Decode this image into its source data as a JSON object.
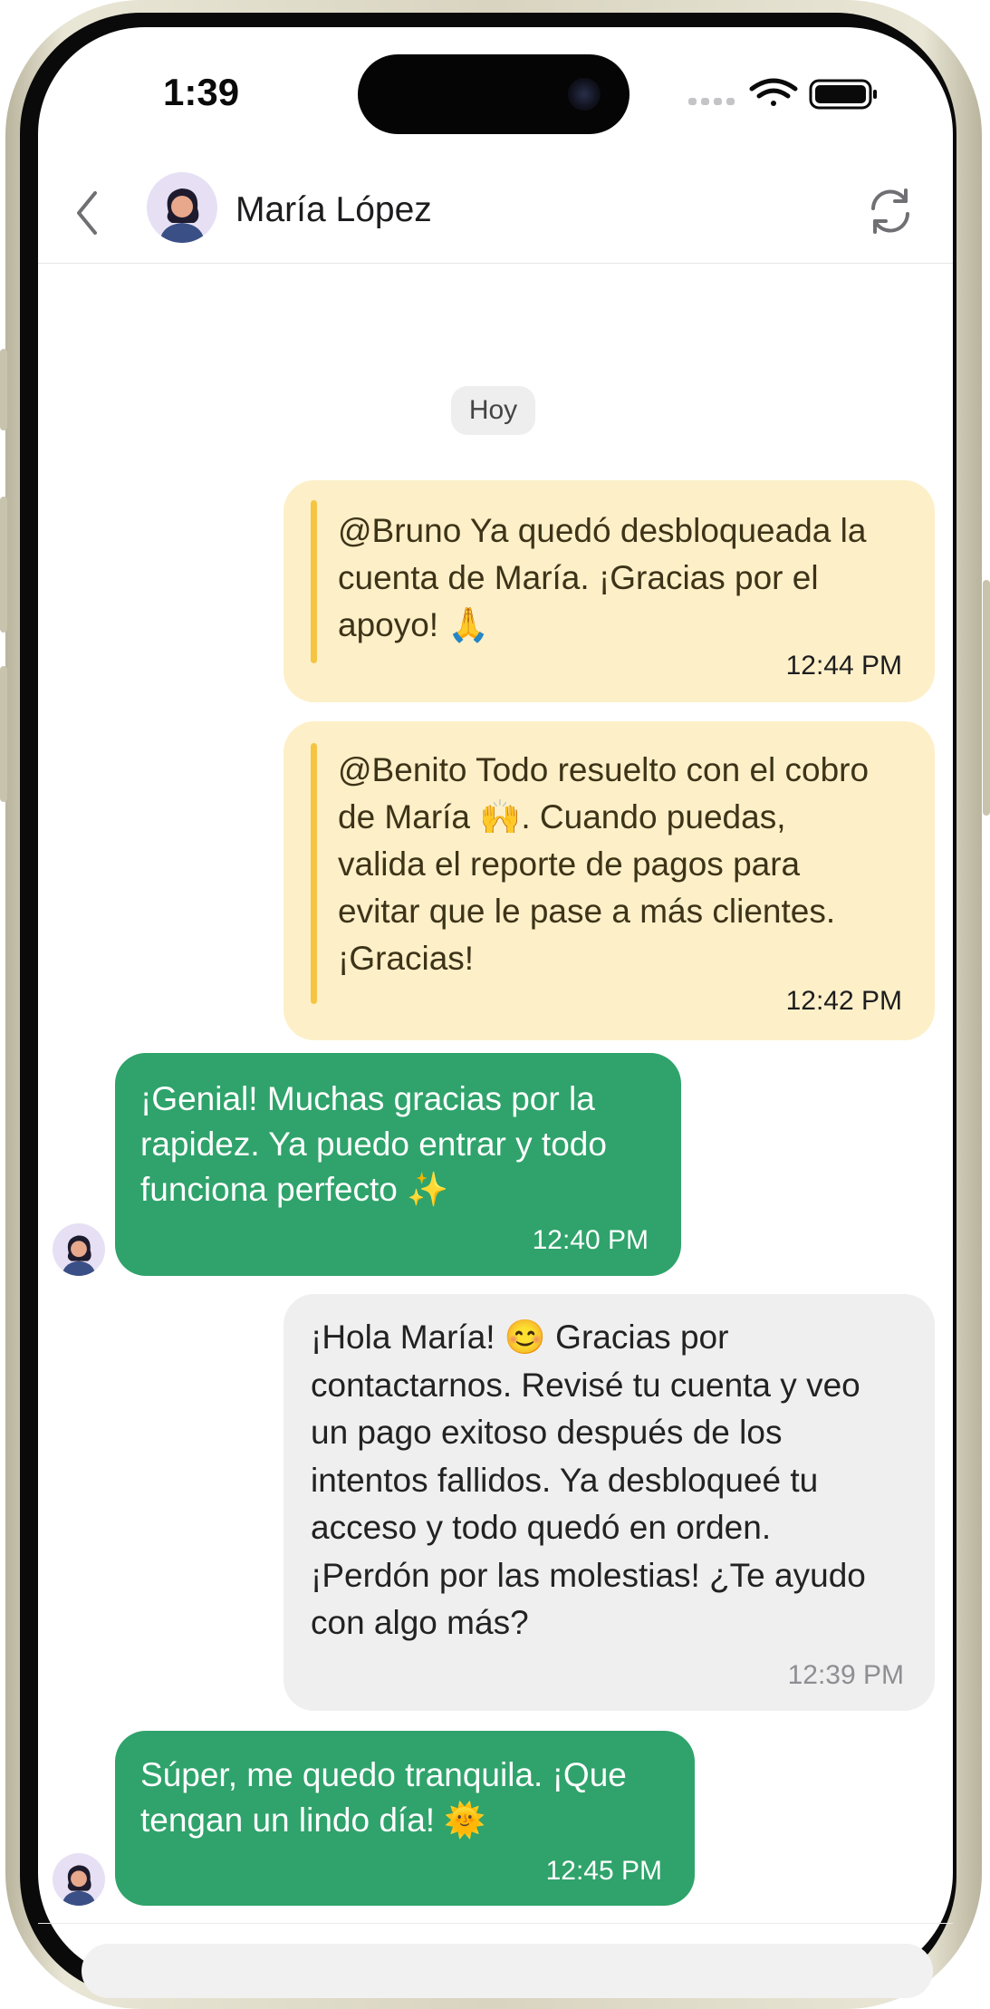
{
  "status_bar": {
    "time": "1:39"
  },
  "header": {
    "contact_name": "María López"
  },
  "date_chip": "Hoy",
  "messages": [
    {
      "kind": "internal-note",
      "lines": [
        "@Bruno Ya quedó desbloqueada la",
        "cuenta de María. ¡Gracias por el",
        "apoyo! 🙏"
      ],
      "time": "12:44 PM"
    },
    {
      "kind": "internal-note",
      "lines": [
        "@Benito Todo resuelto con el cobro",
        "de María 🙌. Cuando puedas,",
        "valida el reporte de pagos para",
        "evitar que le pase a más clientes.",
        "¡Gracias!"
      ],
      "time": "12:42 PM"
    },
    {
      "kind": "customer",
      "lines": [
        "¡Genial! Muchas gracias por la",
        "rapidez. Ya puedo entrar y todo",
        "funciona perfecto ✨"
      ],
      "time": "12:40 PM"
    },
    {
      "kind": "agent",
      "lines": [
        "¡Hola María! 😊 Gracias por",
        "contactarnos. Revisé tu cuenta y veo",
        "un pago exitoso después de los",
        "intentos fallidos. Ya desbloqueé tu",
        "acceso y todo quedó en orden.",
        "¡Perdón por las molestias! ¿Te ayudo",
        "con algo más?"
      ],
      "time": "12:39 PM"
    },
    {
      "kind": "customer",
      "lines": [
        "Súper, me quedo tranquila. ¡Que",
        "tengan un lindo día! 🌞"
      ],
      "time": "12:45 PM"
    }
  ],
  "icons": {
    "back": "chevron-left-icon",
    "refresh": "refresh-icon",
    "signal": "cellular-signal-icon",
    "wifi": "wifi-icon",
    "battery": "battery-icon"
  },
  "colors": {
    "customer_bubble": "#2fa36b",
    "note_bubble": "#fdf0c8",
    "note_bar": "#f5c542",
    "agent_bubble": "#efefef"
  }
}
